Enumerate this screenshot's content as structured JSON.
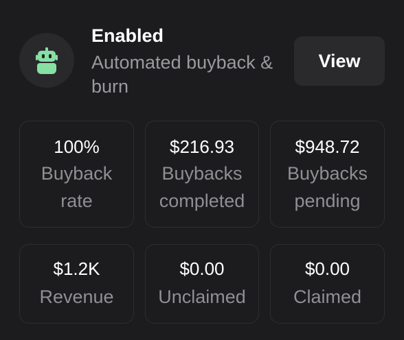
{
  "header": {
    "title": "Enabled",
    "subtitle": "Automated buyback & burn",
    "avatar_icon": "robot-icon",
    "view_label": "View"
  },
  "stats": [
    {
      "value": "100%",
      "label": "Buyback rate"
    },
    {
      "value": "$216.93",
      "label": "Buybacks completed"
    },
    {
      "value": "$948.72",
      "label": "Buybacks pending"
    },
    {
      "value": "$1.2K",
      "label": "Revenue"
    },
    {
      "value": "$0.00",
      "label": "Unclaimed"
    },
    {
      "value": "$0.00",
      "label": "Claimed"
    }
  ],
  "colors": {
    "background": "#1c1c1e",
    "accent_icon": "#86e0a3",
    "muted_text": "#9a9a9f"
  }
}
